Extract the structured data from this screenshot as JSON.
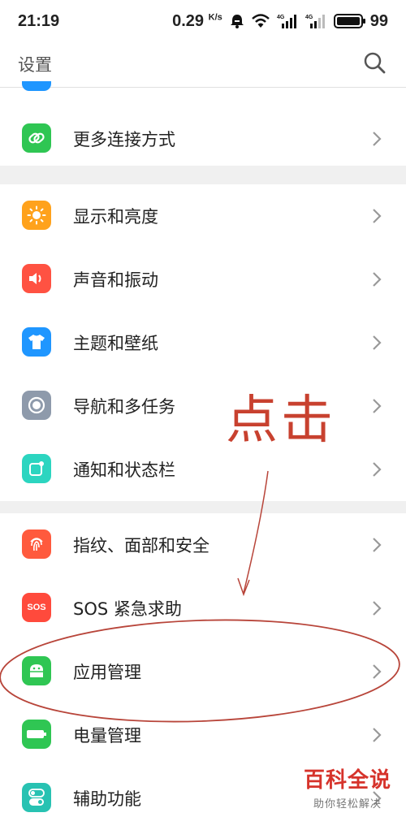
{
  "status_bar": {
    "time": "21:19",
    "speed": "0.29",
    "speed_unit": "K/s",
    "battery": "99",
    "battery_level": 0.99,
    "icons": [
      "alarm-icon",
      "wifi-icon",
      "signal-4g-icon",
      "signal-4g-icon",
      "battery-icon"
    ]
  },
  "header": {
    "title": "设置",
    "search_icon": "search-icon"
  },
  "sections": [
    {
      "items": [
        {
          "label": "更多连接方式",
          "icon": "link-icon",
          "color": "#2fc653"
        }
      ]
    },
    {
      "items": [
        {
          "label": "显示和亮度",
          "icon": "sun-icon",
          "color": "#ffa21c"
        },
        {
          "label": "声音和振动",
          "icon": "speaker-icon",
          "color": "#ff5242"
        },
        {
          "label": "主题和壁纸",
          "icon": "tshirt-icon",
          "color": "#1f96ff"
        },
        {
          "label": "导航和多任务",
          "icon": "navigation-icon",
          "color": "#8e9aab"
        },
        {
          "label": "通知和状态栏",
          "icon": "notification-icon",
          "color": "#2cd5c0"
        }
      ]
    },
    {
      "items": [
        {
          "label": "指纹、面部和安全",
          "icon": "fingerprint-icon",
          "color": "#ff5a3d"
        },
        {
          "label": "SOS 紧急求助",
          "icon": "sos-icon",
          "color": "#ff4a3c",
          "icon_text": "SOS"
        },
        {
          "label": "应用管理",
          "icon": "android-icon",
          "color": "#2fc653"
        },
        {
          "label": "电量管理",
          "icon": "battery-saver-icon",
          "color": "#2fc653"
        },
        {
          "label": "辅助功能",
          "icon": "toggle-icon",
          "color": "#28c2b2"
        }
      ]
    }
  ],
  "annotation": {
    "text": "点击",
    "color": "#c8412f"
  },
  "watermark": {
    "title": "百科全说",
    "subtitle": "助你轻松解决"
  }
}
